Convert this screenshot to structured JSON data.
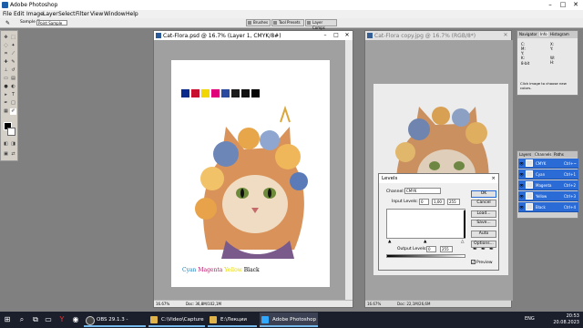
{
  "app": {
    "title": "Adobe Photoshop"
  },
  "menu": [
    "File",
    "Edit",
    "Image",
    "Layer",
    "Select",
    "Filter",
    "View",
    "Window",
    "Help"
  ],
  "options": {
    "sample_size_label": "Sample Size:",
    "sample_size_value": "Point Sample"
  },
  "wells": [
    "Brushes",
    "Tool Presets",
    "Layer Comps"
  ],
  "doc1": {
    "title": "Cat-Flora.psd @ 16.7% (Layer 1, CMYK/8#)",
    "zoom": "16.67%",
    "doc_info": "Doc: 36,8M/102,1M",
    "swatches": [
      "#0a2a8c",
      "#c8102e",
      "#f2d600",
      "#e0007a",
      "#2a4aa0",
      "#1c1c1c",
      "#101010",
      "#050505"
    ],
    "caption": {
      "cyan": "Cyan",
      "magenta": "Magenta",
      "yellow": "Yellow",
      "black": "Black"
    }
  },
  "doc2": {
    "title": "Cat-Flora copy.jpg @ 16.7% (RGB/8*)",
    "zoom": "16.67%",
    "doc_info": "Doc: 22,1M/26,6M"
  },
  "nav_panel": {
    "tabs": [
      "Navigator",
      "Info",
      "Histogram"
    ],
    "active_tab": "Info",
    "values": [
      "C:",
      "M:",
      "Y:",
      "K:",
      "8-bit",
      "X:",
      "Y:",
      "W:",
      "H:"
    ],
    "hint": "Click image to choose new colors."
  },
  "channels_panel": {
    "tabs": [
      "Layers",
      "Channels",
      "Paths"
    ],
    "active_tab": "Channels",
    "channels": [
      {
        "name": "CMYK",
        "shortcut": "Ctrl+~"
      },
      {
        "name": "Cyan",
        "shortcut": "Ctrl+1"
      },
      {
        "name": "Magenta",
        "shortcut": "Ctrl+2"
      },
      {
        "name": "Yellow",
        "shortcut": "Ctrl+3"
      },
      {
        "name": "Black",
        "shortcut": "Ctrl+4"
      }
    ]
  },
  "levels": {
    "title": "Levels",
    "channel_label": "Channel:",
    "channel_value": "CMYK",
    "input_label": "Input Levels:",
    "input_values": [
      "0",
      "1,00",
      "255"
    ],
    "output_label": "Output Levels:",
    "output_values": [
      "0",
      "255"
    ],
    "buttons": {
      "ok": "OK",
      "cancel": "Cancel",
      "load": "Load...",
      "save": "Save...",
      "auto": "Auto",
      "options": "Options..."
    },
    "preview_label": "Preview",
    "close": "×"
  },
  "taskbar": {
    "tasks": [
      "OBS 29.1.3 - Profile...",
      "C:\\Video\\Capture",
      "E:\\Лекции",
      "Adobe Photoshop"
    ],
    "active_task": "Adobe Photoshop",
    "tray_lang": "ENG",
    "time": "20:53",
    "date": "20.08.2023"
  },
  "colors": {
    "accent": "#2b6bd6",
    "taskbar": "#1b1f2c"
  }
}
